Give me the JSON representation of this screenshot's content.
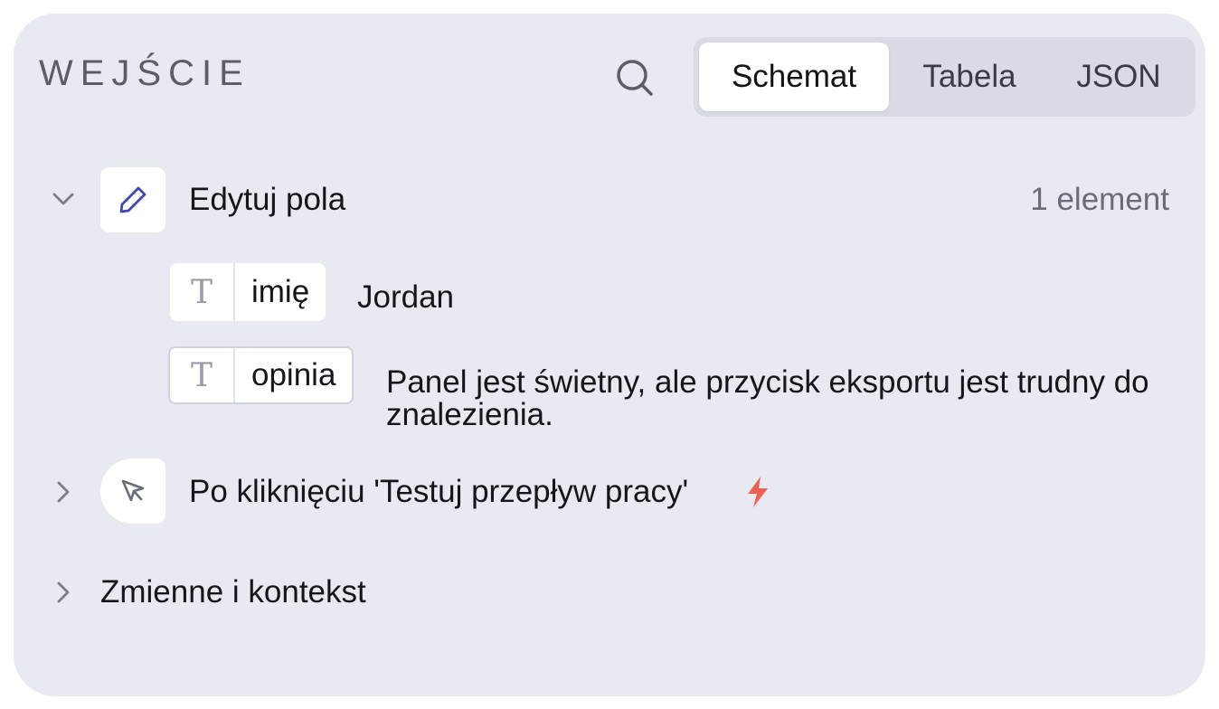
{
  "panel": {
    "title": "WEJŚCIE"
  },
  "toolbar": {
    "search_icon": "search-icon",
    "tabs": [
      {
        "label": "Schemat",
        "active": true
      },
      {
        "label": "Tabela",
        "active": false
      },
      {
        "label": "JSON",
        "active": false
      }
    ]
  },
  "sections": {
    "edit_fields": {
      "label": "Edytuj pola",
      "count": "1 element",
      "expanded": true,
      "icon": "pencil-icon",
      "fields": [
        {
          "type_glyph": "T",
          "name": "imię",
          "value": "Jordan"
        },
        {
          "type_glyph": "T",
          "name": "opinia",
          "value": "Panel jest świetny, ale przycisk eksportu jest trudny do znalezienia."
        }
      ]
    },
    "on_click": {
      "label": "Po kliknięciu 'Testuj przepływ pracy'",
      "expanded": false,
      "icon": "cursor-pointer-icon",
      "badge_icon": "lightning-bolt-icon"
    },
    "variables": {
      "label": "Zmienne i kontekst",
      "expanded": false
    }
  },
  "colors": {
    "panel_bg": "#e9eaf1",
    "tab_track": "#d9dae4",
    "pencil_accent": "#3f47a8",
    "bolt_accent": "#ef5f52"
  }
}
